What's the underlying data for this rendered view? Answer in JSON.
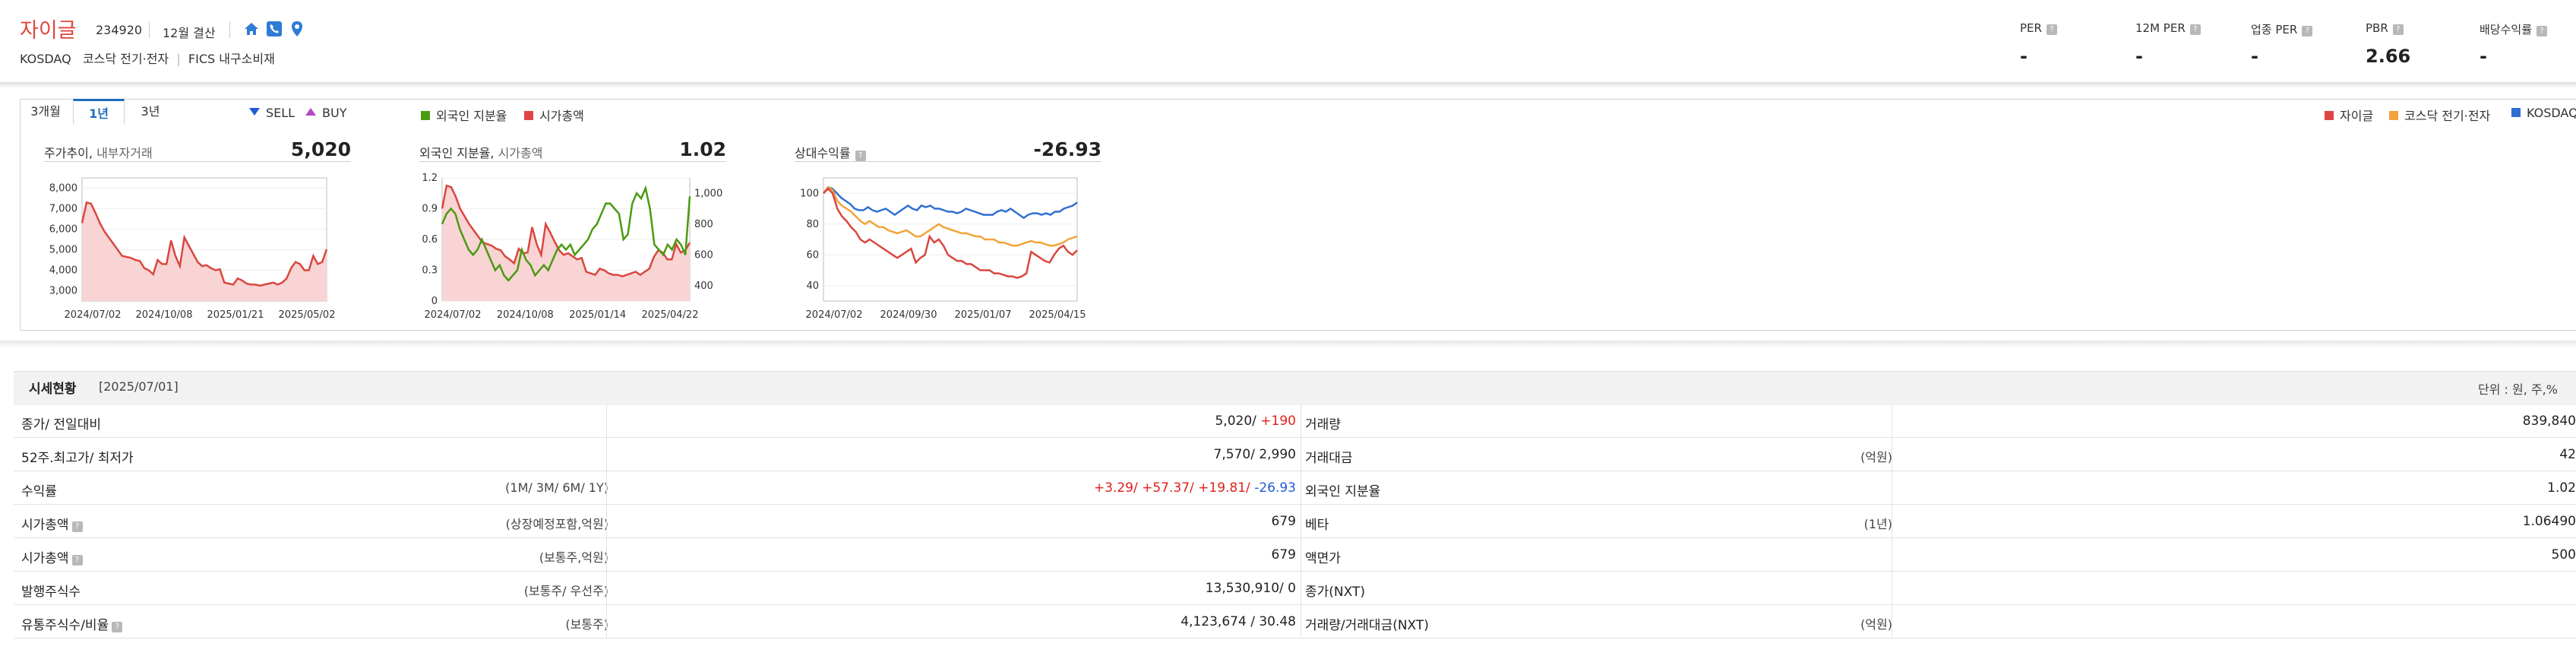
{
  "header": {
    "company_name": "자이글",
    "stock_code": "234920",
    "settlement": "12월 결산",
    "market": "KOSDAQ",
    "sector": "코스닥 전기·전자",
    "fics": "FICS 내구소비재",
    "metrics": [
      {
        "label": "PER",
        "value": "-"
      },
      {
        "label": "12M PER",
        "value": "-"
      },
      {
        "label": "업종 PER",
        "value": "-"
      },
      {
        "label": "PBR",
        "value": "2.66"
      },
      {
        "label": "배당수익률",
        "value": "-"
      }
    ],
    "icons": [
      "home-icon",
      "phone-icon",
      "location-pin-icon"
    ]
  },
  "chart_panel": {
    "tabs": [
      "3개월",
      "1년",
      "3년"
    ],
    "active_tab": "1년",
    "trade_legend": {
      "sell": "SELL",
      "buy": "BUY"
    },
    "foreign_legend": {
      "foreign_ratio": "외국인 지분율",
      "market_cap": "시가총액"
    },
    "relative_legend": {
      "company": "자이글",
      "sector": "코스닥 전기·전자",
      "kosdaq": "KOSDAQ"
    },
    "colors": {
      "red": "#e04545",
      "green": "#4a9a12",
      "orange": "#f2a33a",
      "blue": "#2f6fd2",
      "accent": "#1f6cc0"
    }
  },
  "chart_data": [
    {
      "type": "area",
      "title": "주가추이",
      "subtitle": "내부자거래",
      "headline_value": "5,020",
      "x_ticks": [
        "2024/07/02",
        "2024/10/08",
        "2025/01/21",
        "2025/05/02"
      ],
      "y_ticks": [
        "8,000",
        "7,000",
        "6,000",
        "5,000",
        "4,000",
        "3,000"
      ],
      "ylim": [
        2500,
        8500
      ],
      "series": [
        {
          "values": [
            6300,
            7300,
            7250,
            6800,
            6300,
            5900,
            5600,
            5300,
            5000,
            4700,
            4650,
            4600,
            4500,
            4450,
            4100,
            4000,
            3800,
            4500,
            4300,
            4300,
            5450,
            4700,
            4200,
            5600,
            5200,
            4800,
            4400,
            4200,
            4250,
            4100,
            4000,
            4050,
            3400,
            3350,
            3300,
            3600,
            3500,
            3350,
            3300,
            3300,
            3250,
            3300,
            3350,
            3400,
            3300,
            3400,
            3600,
            4100,
            4400,
            4300,
            4000,
            4000,
            4700,
            4300,
            4400,
            5020
          ]
        }
      ]
    },
    {
      "type": "line",
      "title": "외국인 지분율",
      "subtitle": "시가총액",
      "headline_value": "1.02",
      "x_ticks": [
        "2024/07/02",
        "2024/10/08",
        "2025/01/14",
        "2025/04/22"
      ],
      "y_ticks_left": [
        "1.2",
        "0.9",
        "0.6",
        "0.3",
        "0"
      ],
      "y_ticks_right": [
        "1,000",
        "800",
        "600",
        "400"
      ],
      "ylim_left": [
        0,
        1.2
      ],
      "ylim_right": [
        300,
        1100
      ],
      "series": [
        {
          "name": "외국인 지분율",
          "axis": "left",
          "values": [
            0.75,
            0.85,
            0.9,
            0.85,
            0.7,
            0.6,
            0.5,
            0.45,
            0.5,
            0.6,
            0.5,
            0.4,
            0.3,
            0.35,
            0.25,
            0.2,
            0.25,
            0.3,
            0.5,
            0.4,
            0.35,
            0.25,
            0.3,
            0.35,
            0.3,
            0.4,
            0.5,
            0.55,
            0.5,
            0.55,
            0.45,
            0.5,
            0.55,
            0.6,
            0.7,
            0.75,
            0.85,
            0.95,
            0.95,
            0.9,
            0.85,
            0.6,
            0.65,
            0.95,
            1.05,
            1.0,
            1.1,
            0.9,
            0.55,
            0.5,
            0.45,
            0.55,
            0.5,
            0.6,
            0.55,
            0.45,
            1.02
          ]
        },
        {
          "name": "시가총액",
          "axis": "right",
          "values": [
            900,
            1050,
            1040,
            980,
            900,
            850,
            800,
            760,
            720,
            680,
            670,
            660,
            640,
            630,
            590,
            570,
            545,
            640,
            610,
            615,
            780,
            670,
            600,
            800,
            745,
            685,
            630,
            600,
            610,
            590,
            570,
            580,
            490,
            480,
            470,
            510,
            500,
            480,
            470,
            470,
            460,
            470,
            480,
            490,
            470,
            490,
            510,
            585,
            630,
            615,
            570,
            570,
            670,
            615,
            630,
            679
          ]
        }
      ]
    },
    {
      "type": "line",
      "title": "상대수익률",
      "headline_value": "-26.93",
      "x_ticks": [
        "2024/07/02",
        "2024/09/30",
        "2025/01/07",
        "2025/04/15"
      ],
      "y_ticks": [
        "100",
        "80",
        "60",
        "40"
      ],
      "ylim": [
        30,
        110
      ],
      "series": [
        {
          "name": "자이글",
          "values": [
            100,
            103,
            100,
            90,
            85,
            82,
            78,
            75,
            70,
            68,
            70,
            68,
            66,
            64,
            62,
            60,
            58,
            60,
            62,
            64,
            55,
            58,
            60,
            72,
            68,
            70,
            66,
            60,
            58,
            56,
            56,
            54,
            54,
            52,
            50,
            50,
            50,
            48,
            48,
            47,
            46,
            46,
            45,
            46,
            48,
            62,
            60,
            58,
            56,
            55,
            60,
            64,
            66,
            62,
            60,
            63
          ]
        },
        {
          "name": "코스닥 전기·전자",
          "values": [
            100,
            104,
            102,
            95,
            92,
            90,
            88,
            85,
            82,
            80,
            82,
            80,
            78,
            78,
            76,
            75,
            74,
            75,
            76,
            74,
            72,
            72,
            74,
            76,
            78,
            80,
            78,
            77,
            76,
            75,
            74,
            74,
            73,
            72,
            72,
            70,
            70,
            70,
            68,
            68,
            67,
            66,
            66,
            67,
            68,
            69,
            68,
            68,
            67,
            66,
            66,
            67,
            68,
            70,
            71,
            72
          ]
        },
        {
          "name": "KOSDAQ",
          "values": [
            100,
            104,
            103,
            100,
            97,
            95,
            93,
            90,
            89,
            89,
            91,
            89,
            88,
            89,
            90,
            88,
            86,
            88,
            90,
            92,
            90,
            89,
            92,
            91,
            92,
            90,
            90,
            89,
            88,
            88,
            87,
            88,
            90,
            89,
            88,
            87,
            86,
            86,
            86,
            88,
            89,
            88,
            90,
            88,
            86,
            84,
            86,
            87,
            87,
            86,
            87,
            86,
            88,
            88,
            90,
            91,
            92,
            94
          ]
        }
      ]
    }
  ],
  "market_table": {
    "title": "시세현황",
    "date": "[2025/07/01]",
    "unit": "단위 : 원, 주,%",
    "rows": [
      {
        "left_label": "종가/ 전일대비",
        "left_sub": "",
        "left_value": "5,020/",
        "left_value_extra": "+190",
        "right_label": "거래량",
        "right_sub": "",
        "right_value": "839,840"
      },
      {
        "left_label": "52주.최고가/ 최저가",
        "left_sub": "",
        "left_value": "7,570/ 2,990",
        "left_value_extra": "",
        "right_label": "거래대금",
        "right_sub": "(억원)",
        "right_value": "42"
      },
      {
        "left_label": "수익률",
        "left_sub": "(1M/ 3M/ 6M/ 1Y)",
        "returns": [
          "+3.29/",
          "+57.37/",
          "+19.81/",
          "-26.93"
        ],
        "right_label": "외국인 지분율",
        "right_sub": "",
        "right_value": "1.02"
      },
      {
        "left_label": "시가총액",
        "left_sub": "(상장예정포함,억원)",
        "left_value": "679",
        "left_value_extra": "",
        "right_label": "베타",
        "right_sub": "(1년)",
        "right_value": "1.06490"
      },
      {
        "left_label": "시가총액",
        "left_sub": "(보통주,억원)",
        "left_value": "679",
        "left_value_extra": "",
        "right_label": "액면가",
        "right_sub": "",
        "right_value": "500"
      },
      {
        "left_label": "발행주식수",
        "left_sub": "(보통주/ 우선주)",
        "left_value": "13,530,910/ 0",
        "left_value_extra": "",
        "right_label": "종가(NXT)",
        "right_sub": "",
        "right_value": ""
      },
      {
        "left_label": "유통주식수/비율",
        "left_sub": "(보통주)",
        "left_value": "4,123,674 / 30.48",
        "left_value_extra": "",
        "right_label": "거래량/거래대금(NXT)",
        "right_sub": "(억원)",
        "right_value": ""
      }
    ]
  }
}
